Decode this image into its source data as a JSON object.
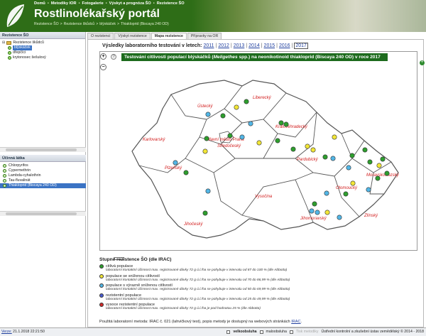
{
  "header": {
    "nav": [
      "Domů",
      "Metodiky IOR",
      "Fotogalerie",
      "Výskyt a prognóza ŠO",
      "Rezistence ŠO"
    ],
    "title": "Rostlinolékařský portál",
    "breadcrumb": [
      "Rezistence ŠO",
      ">",
      "Rezistence škůdců",
      ">",
      "blýskáček",
      ">",
      "Thiakloprid (Biscaya 240 OD)"
    ]
  },
  "left_panel": {
    "title": "Rezistence ŠO",
    "tree": [
      {
        "label": "Rezistence škůdců",
        "level": 0
      },
      {
        "label": "blýskáček",
        "level": 1,
        "selected": true
      },
      {
        "label": "dřepčíci",
        "level": 1
      },
      {
        "label": "krytonosec šešulový",
        "level": 1
      }
    ],
    "sub_title": "Účinná látka",
    "substances": [
      {
        "label": "Chlorpyrifos"
      },
      {
        "label": "Cypermethrin"
      },
      {
        "label": "Lambda-cyhalothrin"
      },
      {
        "label": "Tau-fluvalinát"
      },
      {
        "label": "Thiakloprid (Biscaya 240 OD)",
        "selected": true
      }
    ]
  },
  "tabs": [
    "O rezistenci",
    "Výskyt rezistence",
    "Mapa rezistence",
    "Přípravky na OR"
  ],
  "active_tab": "Mapa rezistence",
  "years_label": "Výsledky laboratorního testování v letech:",
  "years": [
    "2011",
    "2012",
    "2013",
    "2014",
    "2015",
    "2016",
    "2017"
  ],
  "current_year": "2017",
  "map": {
    "title_pre": "Testování citlivosti populací blýskáčků (",
    "title_italic": "Meligethes",
    "title_post": " spp.) na neonikotinoid thiakloprid (Biscaya 240 OD) v roce 2017",
    "zoom_in": "+",
    "zoom_out": "−",
    "help": "?",
    "regions": [
      "Liberecký",
      "Ústecký",
      "Karlovarský",
      "Královéhradecký",
      "Hlavní město Praha",
      "Středočeský",
      "Pardubický",
      "Plzeňský",
      "Moravskoslezský",
      "Olomoucký",
      "Vysočina",
      "Jihomoravský",
      "Zlínský",
      "Jihočeský"
    ],
    "colors": {
      "citliva": "#2e9e2e",
      "snizena": "#f2e637",
      "vyrazne": "#52b6e6",
      "rezistentni": "#4a5ccf",
      "vysoce": "#d12a2a"
    }
  },
  "legend": {
    "title": "Stupně rezistence ŠO (dle IRAC)",
    "items": [
      {
        "name": "citlivá populace",
        "desc": "laboratorní kontaktní účinnost max. registrované dávky 72 g ú.l./ha se pohybuje v intervalu od 87 do 100 % (dle Abbotta)",
        "color": "#2e9e2e"
      },
      {
        "name": "populace se sníženou citlivostí",
        "desc": "laboratorní kontaktní účinnost max. registrované dávky 72 g ú.l./ha se pohybuje v intervalu od 70 do 86,99 % (dle Abbotta)",
        "color": "#f2e637"
      },
      {
        "name": "populace s výrazně sníženou citlivostí",
        "desc": "laboratorní kontaktní účinnost max. registrované dávky 72 g ú.l./ha se pohybuje v intervalu od 50 do 69,99 % (dle Abbotta)",
        "color": "#52b6e6"
      },
      {
        "name": "rezistentní populace",
        "desc": "laboratorní kontaktní účinnost max. registrované dávky 72 g ú.l./ha se pohybuje v intervalu od 25 do 49,99 % (dle Abbotta)",
        "color": "#4a5ccf"
      },
      {
        "name": "vysoce rezistentní populace",
        "desc": "laboratorní kontaktní účinnost max. registrované dávky 72 g ú.l./ha je pod hodnotou 25 % (dle Abbotta)",
        "color": "#d12a2a"
      }
    ]
  },
  "method": {
    "text": "Použitá laboratorní metoda: IRAC č. 021 (lahvičkový test), popis metody je dostupný na webových stránkách",
    "link": "IRAC",
    "end": "."
  },
  "footer": {
    "version_label": "Verze:",
    "version": "21.1.2018 22:21:50",
    "opt1": "velkoobsluha",
    "opt2": "maloobsluha",
    "opt3": "Tisk metodiky",
    "copyright": "Ústřední kontrolní a zkušební ústav zemědělský © 2014 - 2018"
  }
}
